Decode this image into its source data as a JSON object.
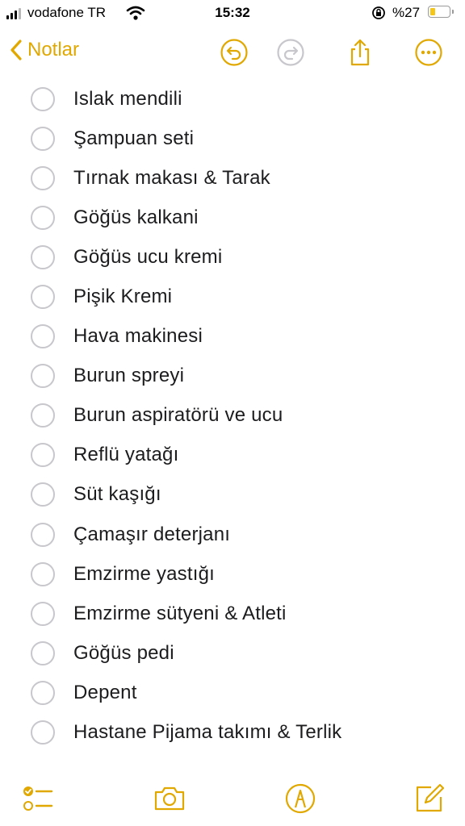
{
  "status_bar": {
    "carrier": "vodafone TR",
    "time": "15:32",
    "battery_percent": "%27",
    "battery_level": 0.27
  },
  "nav": {
    "back_label": "Notlar"
  },
  "checklist": [
    "Islak mendili",
    "Şampuan seti",
    "Tırnak makası & Tarak",
    "Göğüs kalkani",
    "Göğüs ucu kremi",
    "Pişik Kremi",
    "Hava makinesi",
    "Burun spreyi",
    "Burun aspiratörü ve ucu",
    "Reflü yatağı",
    "Süt kaşığı",
    "Çamaşır deterjanı",
    "Emzirme yastığı",
    "Emzirme sütyeni & Atleti",
    "Göğüs pedi",
    "Depent",
    "Hastane Pijama takımı & Terlik"
  ],
  "icons": {
    "undo": "undo-icon",
    "redo": "redo-icon",
    "share": "share-icon",
    "more": "more-icon",
    "checklist": "checklist-icon",
    "camera": "camera-icon",
    "markup": "markup-icon",
    "compose": "compose-icon"
  },
  "colors": {
    "accent": "#e0a800",
    "disabled": "#c7c7cc",
    "text": "#1c1c1e"
  }
}
